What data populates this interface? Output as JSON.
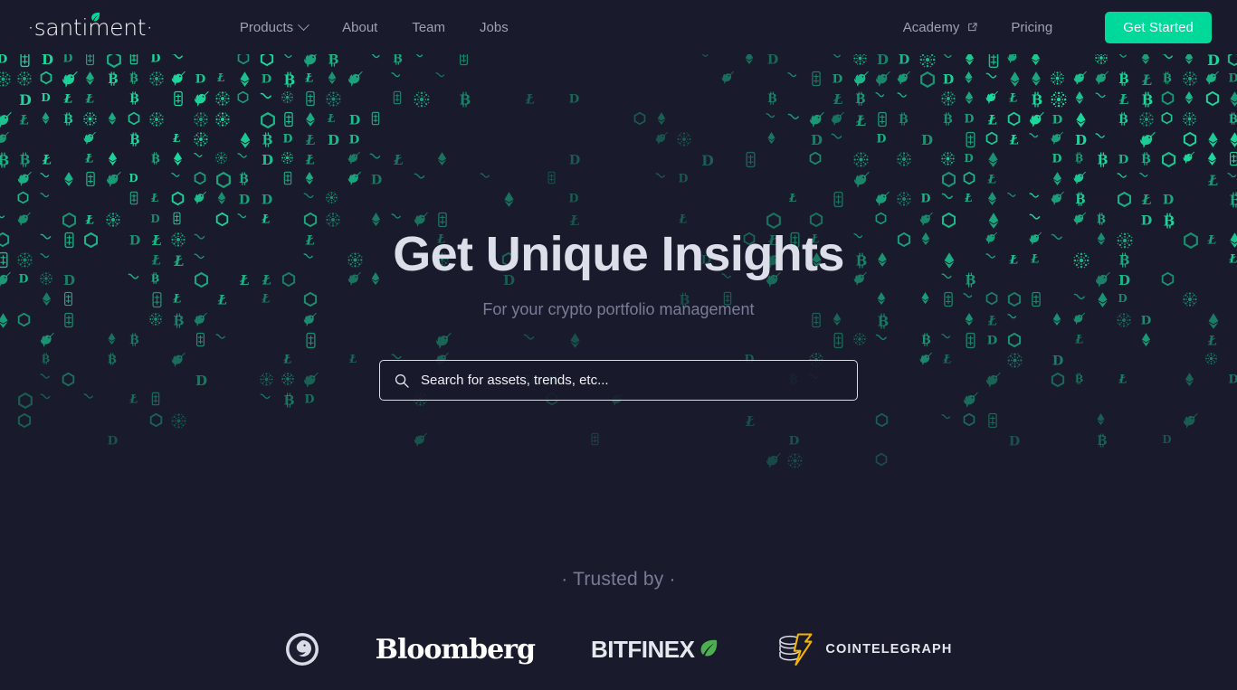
{
  "theme": {
    "background": "#191a2b",
    "accent": "#00d99a",
    "pattern_color": "#18b88a",
    "heading_color": "#dcdeea",
    "muted_text": "#787c96"
  },
  "header": {
    "brand": {
      "name": "·santiment·",
      "icon": "leaf-icon"
    },
    "nav": [
      {
        "label": "Products",
        "has_dropdown": true,
        "icon": "chevron-down-icon"
      },
      {
        "label": "About",
        "has_dropdown": false
      },
      {
        "label": "Team",
        "has_dropdown": false
      },
      {
        "label": "Jobs",
        "has_dropdown": false
      }
    ],
    "nav_right": [
      {
        "label": "Academy",
        "icon": "external-link-icon"
      },
      {
        "label": "Pricing",
        "icon": null
      }
    ],
    "cta": {
      "label": "Get Started",
      "color": "#00d99a"
    }
  },
  "hero": {
    "title": "Get Unique Insights",
    "subtitle": "For your crypto portfolio management"
  },
  "search": {
    "placeholder": "Search for assets, trends, etc...",
    "value": "",
    "icon": "search-icon"
  },
  "trusted": {
    "label": "· Trusted by ·",
    "logos": [
      {
        "name": "seal-emblem",
        "text": "",
        "icon": "circular-seal-icon"
      },
      {
        "name": "bloomberg",
        "text": "Bloomberg",
        "icon": null
      },
      {
        "name": "bitfinex",
        "text": "BITFINEX",
        "icon": "leaf-icon"
      },
      {
        "name": "cointelegraph",
        "text": "COINTELEGRAPH",
        "icon": "coin-bolt-icon"
      }
    ]
  },
  "pattern": {
    "symbols": [
      "eth",
      "xrp",
      "usdt",
      "btc",
      "dot",
      "ltc",
      "link",
      "uni",
      "dai"
    ],
    "symbol_labels": {
      "eth": "Ethereum",
      "xrp": "XRP",
      "usdt": "Tether",
      "btc": "Bitcoin",
      "dot": "Polkadot",
      "ltc": "Litecoin",
      "link": "Chainlink",
      "uni": "Uniswap",
      "dai": "Dai"
    },
    "color": "#18b88a",
    "cols": 57,
    "rows": 21,
    "cell_w": 24.3,
    "cell_h": 22.2
  }
}
